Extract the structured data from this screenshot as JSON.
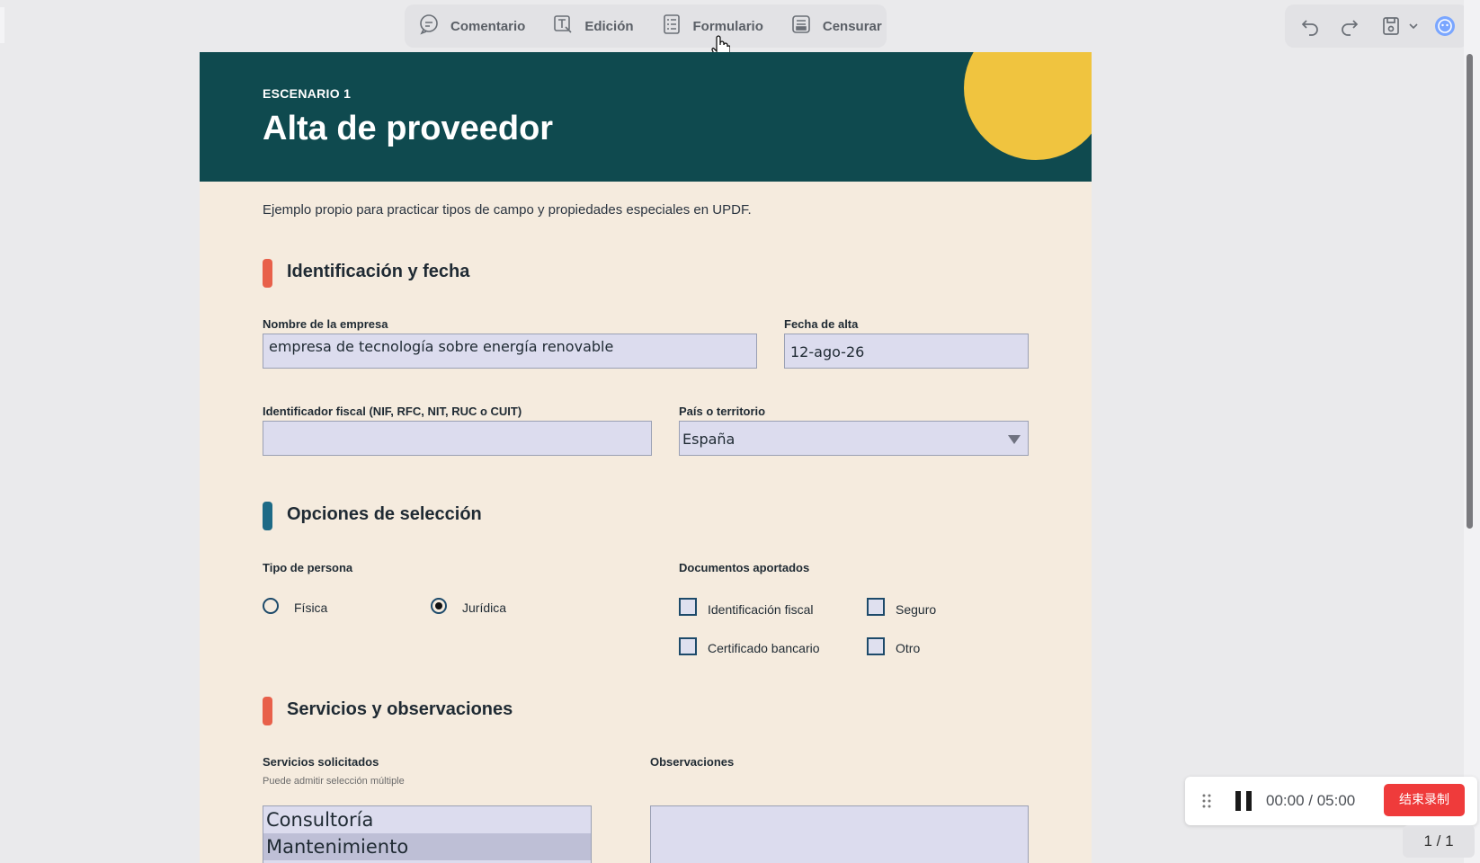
{
  "toolbar": {
    "items": [
      {
        "label": "Comentario",
        "icon": "comment-icon"
      },
      {
        "label": "Edición",
        "icon": "edit-text-icon"
      },
      {
        "label": "Formulario",
        "icon": "form-icon"
      },
      {
        "label": "Censurar",
        "icon": "redact-icon"
      }
    ],
    "right": [
      "undo-icon",
      "redo-icon",
      "save-icon",
      "chevron-down-icon",
      "ai-assistant-icon"
    ]
  },
  "document": {
    "eyebrow": "ESCENARIO 1",
    "title": "Alta de proveedor",
    "intro": "Ejemplo propio para practicar tipos de campo y propiedades especiales en UPDF.",
    "colors": {
      "banner": "#0f4a4f",
      "accent_circle": "#f0c43f",
      "paper": "#f5ebde",
      "bar_red": "#e8604a",
      "bar_blue": "#1d6a86"
    },
    "sections": {
      "s1": {
        "title": "Identificación y fecha"
      },
      "s2": {
        "title": "Opciones de selección"
      },
      "s3": {
        "title": "Servicios y observaciones"
      }
    },
    "fields": {
      "empresa": {
        "label": "Nombre de la empresa",
        "value": "empresa de tecnología sobre energía renovable"
      },
      "fecha": {
        "label": "Fecha de alta",
        "value": "12-ago-26"
      },
      "nif": {
        "label": "Identificador fiscal (NIF, RFC, NIT, RUC o CUIT)",
        "value": ""
      },
      "pais": {
        "label": "País o territorio",
        "value": "España"
      },
      "tipo": {
        "label": "Tipo de persona",
        "options": [
          "Física",
          "Jurídica"
        ],
        "selected": "Jurídica"
      },
      "docs": {
        "label": "Documentos aportados",
        "options": [
          "Identificación fiscal",
          "Seguro",
          "Certificado bancario",
          "Otro"
        ]
      },
      "servicios": {
        "label": "Servicios solicitados",
        "hint": "Puede admitir selección múltiple",
        "items": [
          "Consultoría",
          "Mantenimiento"
        ],
        "selected": "Mantenimiento"
      },
      "obs": {
        "label": "Observaciones",
        "value": ""
      }
    }
  },
  "recording": {
    "time": "00:00 / 05:00",
    "end_label": "结束录制"
  },
  "page_indicator": "1 / 1"
}
